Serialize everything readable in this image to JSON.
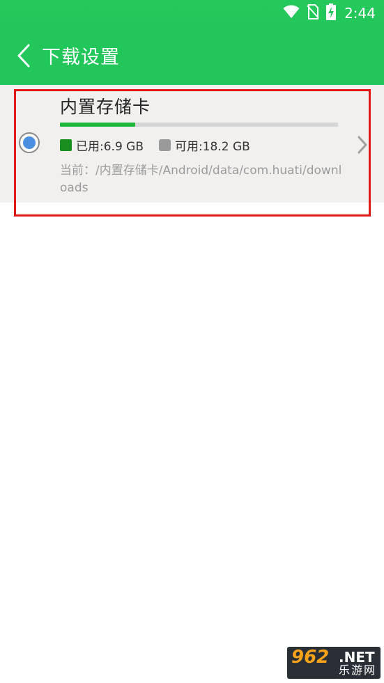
{
  "status_bar": {
    "time": "2:44",
    "icons": [
      "wifi-icon",
      "no-sim-icon",
      "battery-charging-icon"
    ]
  },
  "app_bar": {
    "back_icon": "chevron-left-icon",
    "title": "下载设置"
  },
  "storage": {
    "name": "内置存储卡",
    "selected": true,
    "used_fraction": 0.27,
    "used_label": "已用:6.9 GB",
    "free_label": "可用:18.2 GB",
    "path": "当前：/内置存储卡/Android/data/com.huati/downloads",
    "used_color": "#1a8f1f",
    "free_color": "#9a9a9a",
    "bar_color": "#1eb83b"
  },
  "colors": {
    "accent": "#23c65a",
    "highlight": "#e01818",
    "radio": "#4a8fe0"
  },
  "watermark": {
    "number": "962",
    "domain": ".NET",
    "chinese": "乐游网"
  }
}
